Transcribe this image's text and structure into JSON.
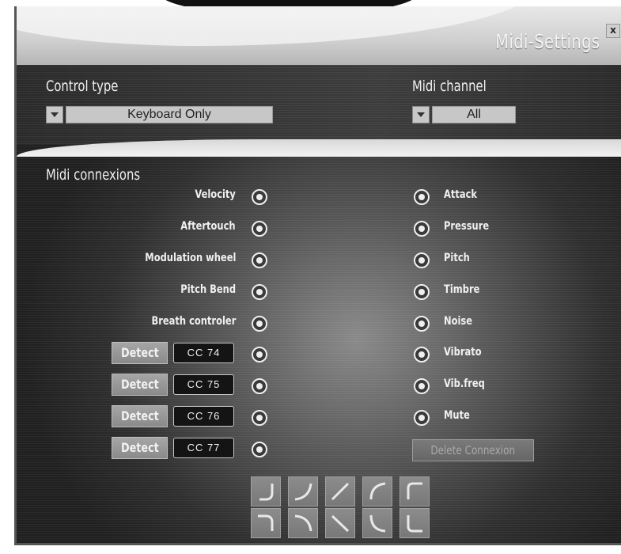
{
  "window": {
    "title": "Midi-Settings",
    "close_label": "x"
  },
  "control_type": {
    "label": "Control type",
    "value": "Keyboard Only"
  },
  "midi_channel": {
    "label": "Midi channel",
    "value": "All"
  },
  "connexions": {
    "heading": "Midi connexions",
    "sources": [
      {
        "label": "Velocity"
      },
      {
        "label": "Aftertouch"
      },
      {
        "label": "Modulation wheel"
      },
      {
        "label": "Pitch Bend"
      },
      {
        "label": "Breath controler"
      }
    ],
    "cc_sources": [
      {
        "detect_label": "Detect",
        "cc": "CC 74"
      },
      {
        "detect_label": "Detect",
        "cc": "CC 75"
      },
      {
        "detect_label": "Detect",
        "cc": "CC 76"
      },
      {
        "detect_label": "Detect",
        "cc": "CC 77"
      }
    ],
    "targets": [
      {
        "label": "Attack"
      },
      {
        "label": "Pressure"
      },
      {
        "label": "Pitch"
      },
      {
        "label": "Timbre"
      },
      {
        "label": "Noise"
      },
      {
        "label": "Vibrato"
      },
      {
        "label": "Vib.freq"
      },
      {
        "label": "Mute"
      }
    ],
    "delete_label": "Delete Connexion"
  },
  "curve_buttons": [
    "curve-convex-up-icon",
    "curve-concave-up-icon",
    "curve-linear-up-icon",
    "curve-arc-up-icon",
    "curve-step-up-icon",
    "curve-convex-down-icon",
    "curve-concave-down-icon",
    "curve-linear-down-icon",
    "curve-arc-down-icon",
    "curve-step-down-icon"
  ],
  "colors": {
    "panel_dark": "#2e2e2e",
    "text_light": "#f0f0f0",
    "button_gray": "#8a8a8a"
  }
}
